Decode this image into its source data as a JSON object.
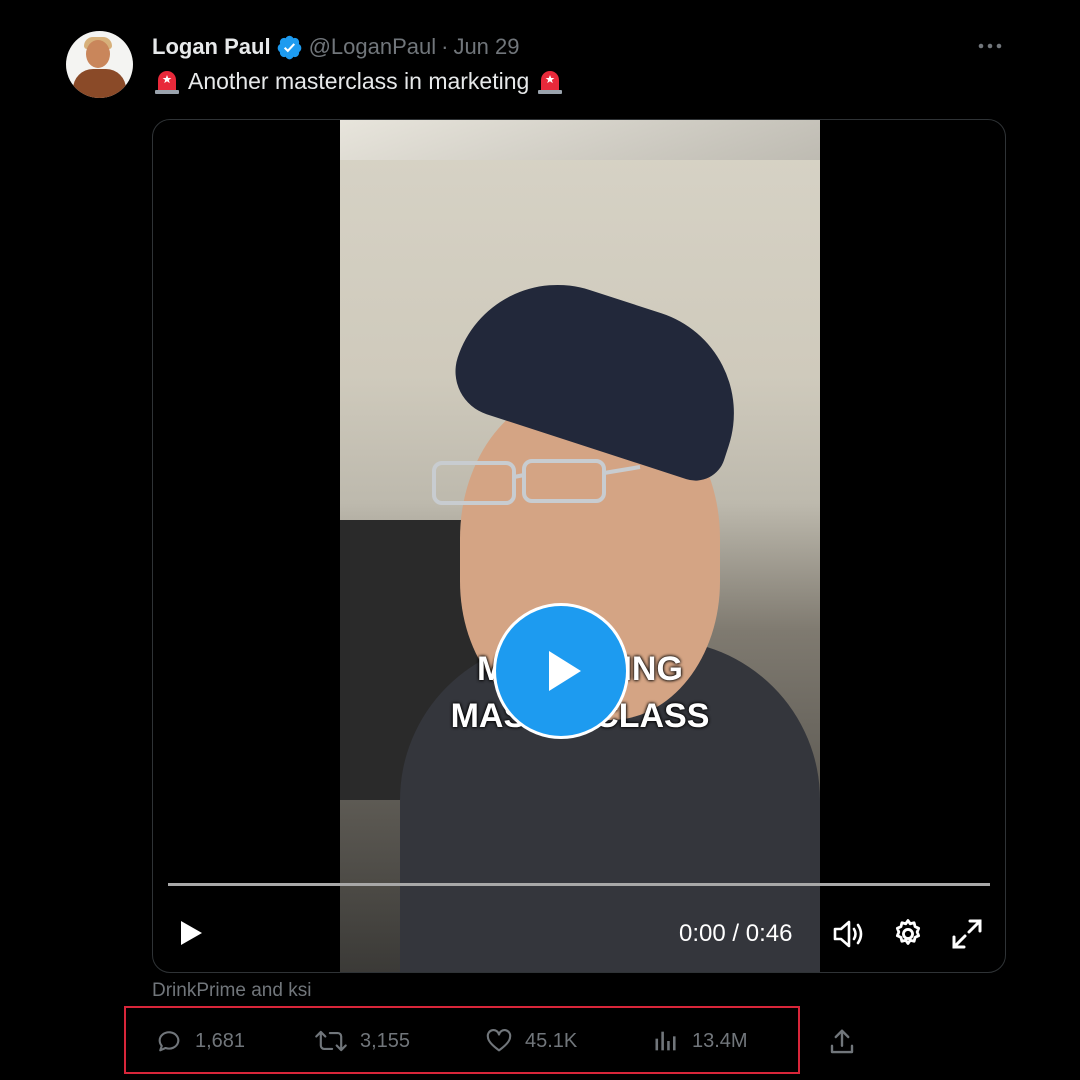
{
  "tweet": {
    "author_name": "Logan Paul",
    "handle": "@LoganPaul",
    "separator": "·",
    "date": "Jun 29",
    "text": "Another masterclass in marketing",
    "leading_emoji": "siren-icon",
    "trailing_emoji": "siren-icon"
  },
  "video": {
    "overlay_line1": "MARKETING",
    "overlay_line2": "MASTERCLASS",
    "time": "0:00 / 0:46",
    "progress": 0.0
  },
  "attribution": "DrinkPrime and ksi",
  "actions": {
    "replies": "1,681",
    "reposts": "3,155",
    "likes": "45.1K",
    "views": "13.4M"
  },
  "colors": {
    "accent": "#1d9bf0",
    "muted": "#71767b",
    "highlight": "#d9263a",
    "background": "#000000"
  }
}
